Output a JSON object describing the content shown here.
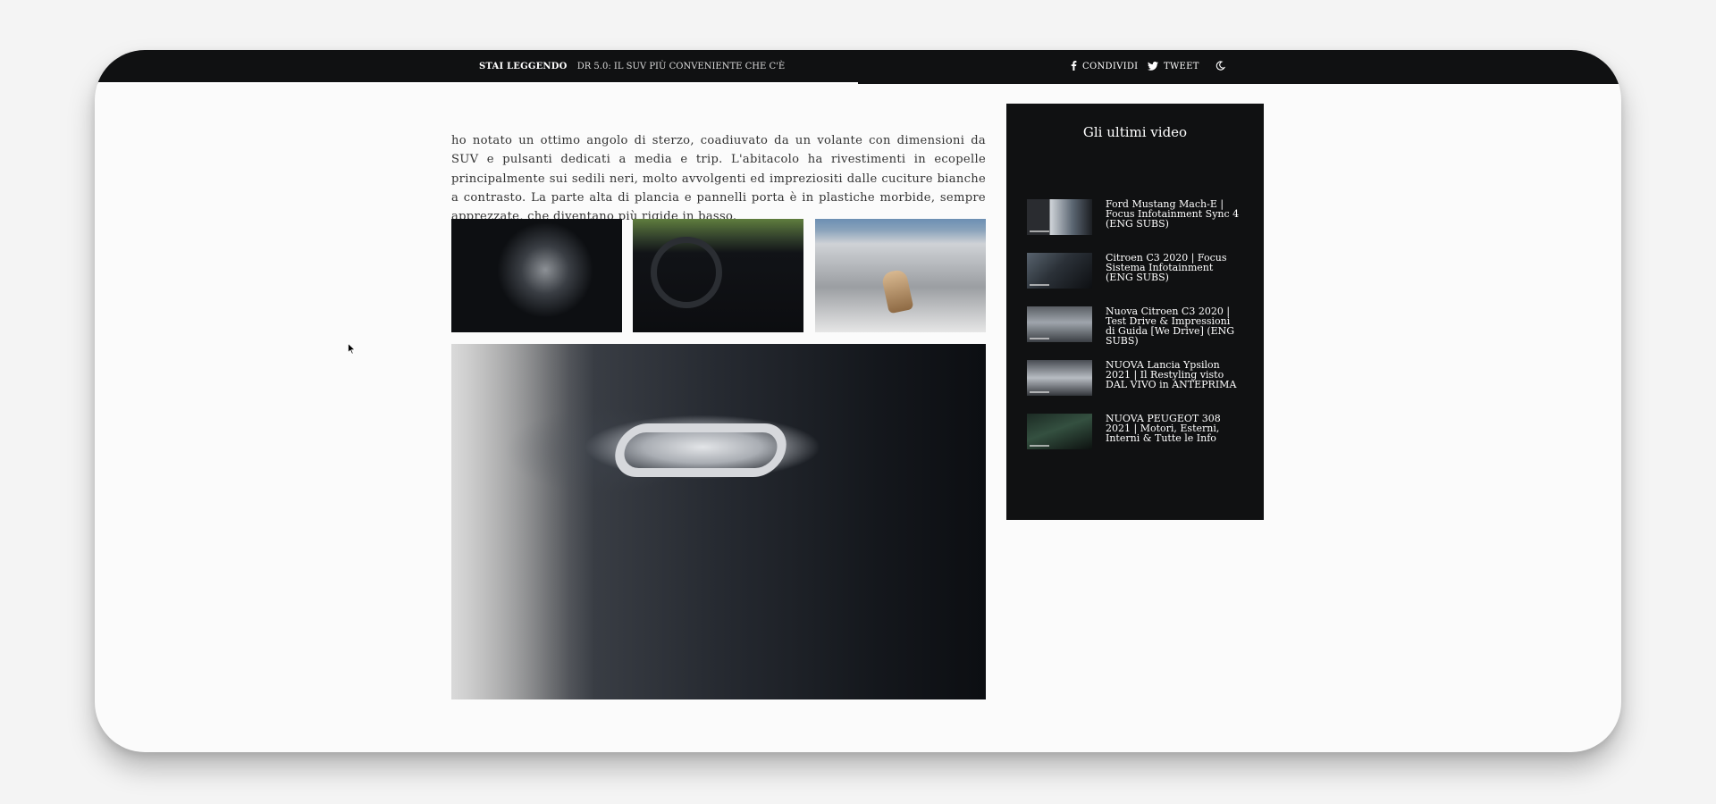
{
  "topbar": {
    "reading_label": "STAI LEGGENDO",
    "reading_title": "DR 5.0: IL SUV PIÙ CONVENIENTE CHE C'È",
    "progress_fraction": 0.5,
    "share_facebook": "CONDIVIDI",
    "share_twitter": "TWEET",
    "icons": [
      "facebook-icon",
      "twitter-icon",
      "dark-mode-icon"
    ]
  },
  "article": {
    "paragraph": "ho notato un ottimo angolo di sterzo, coadiuvato da un volante con dimensioni da SUV e pulsanti dedicati a media e trip. L'abitacolo ha rivestimenti in ecopelle principalmente sui sedili neri, molto avvolgenti ed impreziositi dalle cuciture bianche a contrasto. La parte alta di plancia e pannelli porta è in plastiche morbide, sempre apprezzate, che diventano più rigide in basso."
  },
  "sidebar": {
    "title": "Gli ultimi video",
    "videos": [
      {
        "title": "Ford Mustang Mach-E | Focus Infotainment Sync 4 (ENG SUBS)"
      },
      {
        "title": "Citroen C3 2020 | Focus Sistema Infotainment (ENG SUBS)"
      },
      {
        "title": "Nuova Citroen C3 2020 | Test Drive & Impressioni di Guida [We Drive] (ENG SUBS)"
      },
      {
        "title": "NUOVA Lancia Ypsilon 2021 | Il Restyling visto DAL VIVO in ANTEPRIMA"
      },
      {
        "title": "NUOVA PEUGEOT 308 2021 | Motori, Esterni, Interni & Tutte le Info"
      }
    ]
  },
  "colors": {
    "bar_background": "#101112",
    "page_background": "#fbfbfb",
    "text": "#333333"
  }
}
